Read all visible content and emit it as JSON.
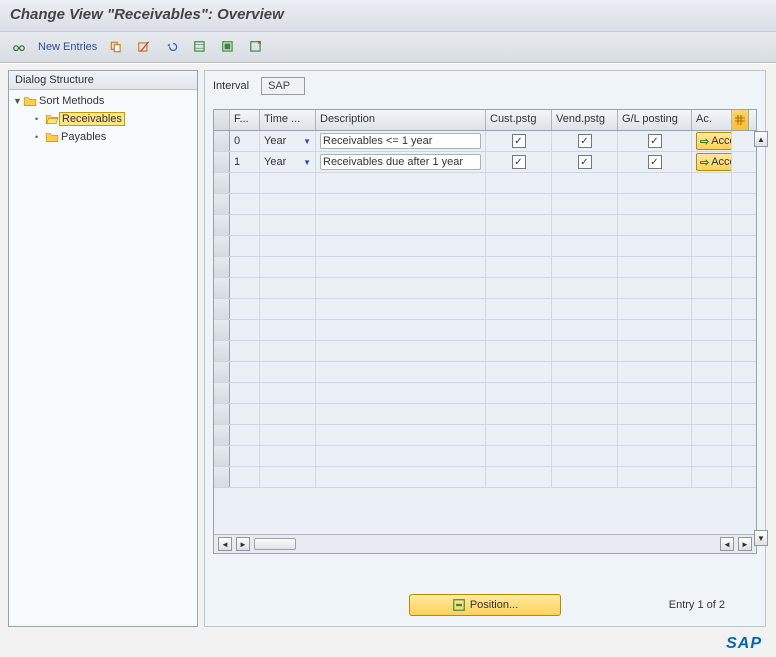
{
  "title": "Change View \"Receivables\": Overview",
  "toolbar": {
    "new_entries": "New Entries"
  },
  "sidebar": {
    "title": "Dialog Structure",
    "root": "Sort Methods",
    "items": [
      {
        "label": "Receivables",
        "selected": true
      },
      {
        "label": "Payables",
        "selected": false
      }
    ]
  },
  "interval": {
    "label": "Interval",
    "value": "SAP"
  },
  "grid": {
    "headers": {
      "f": "F...",
      "time": "Time ...",
      "desc": "Description",
      "cust": "Cust.pstg",
      "vend": "Vend.pstg",
      "gl": "G/L posting",
      "ac": "Ac."
    },
    "rows": [
      {
        "f": "0",
        "time": "Year",
        "desc": "Receivables <= 1 year",
        "cust": true,
        "vend": true,
        "gl": true,
        "ac": "Accc"
      },
      {
        "f": "1",
        "time": "Year",
        "desc": "Receivables due after 1 year",
        "cust": true,
        "vend": true,
        "gl": true,
        "ac": "Accc"
      }
    ],
    "empty_rows": 15
  },
  "footer": {
    "position": "Position...",
    "entry": "Entry 1 of 2"
  },
  "logo": "SAP"
}
